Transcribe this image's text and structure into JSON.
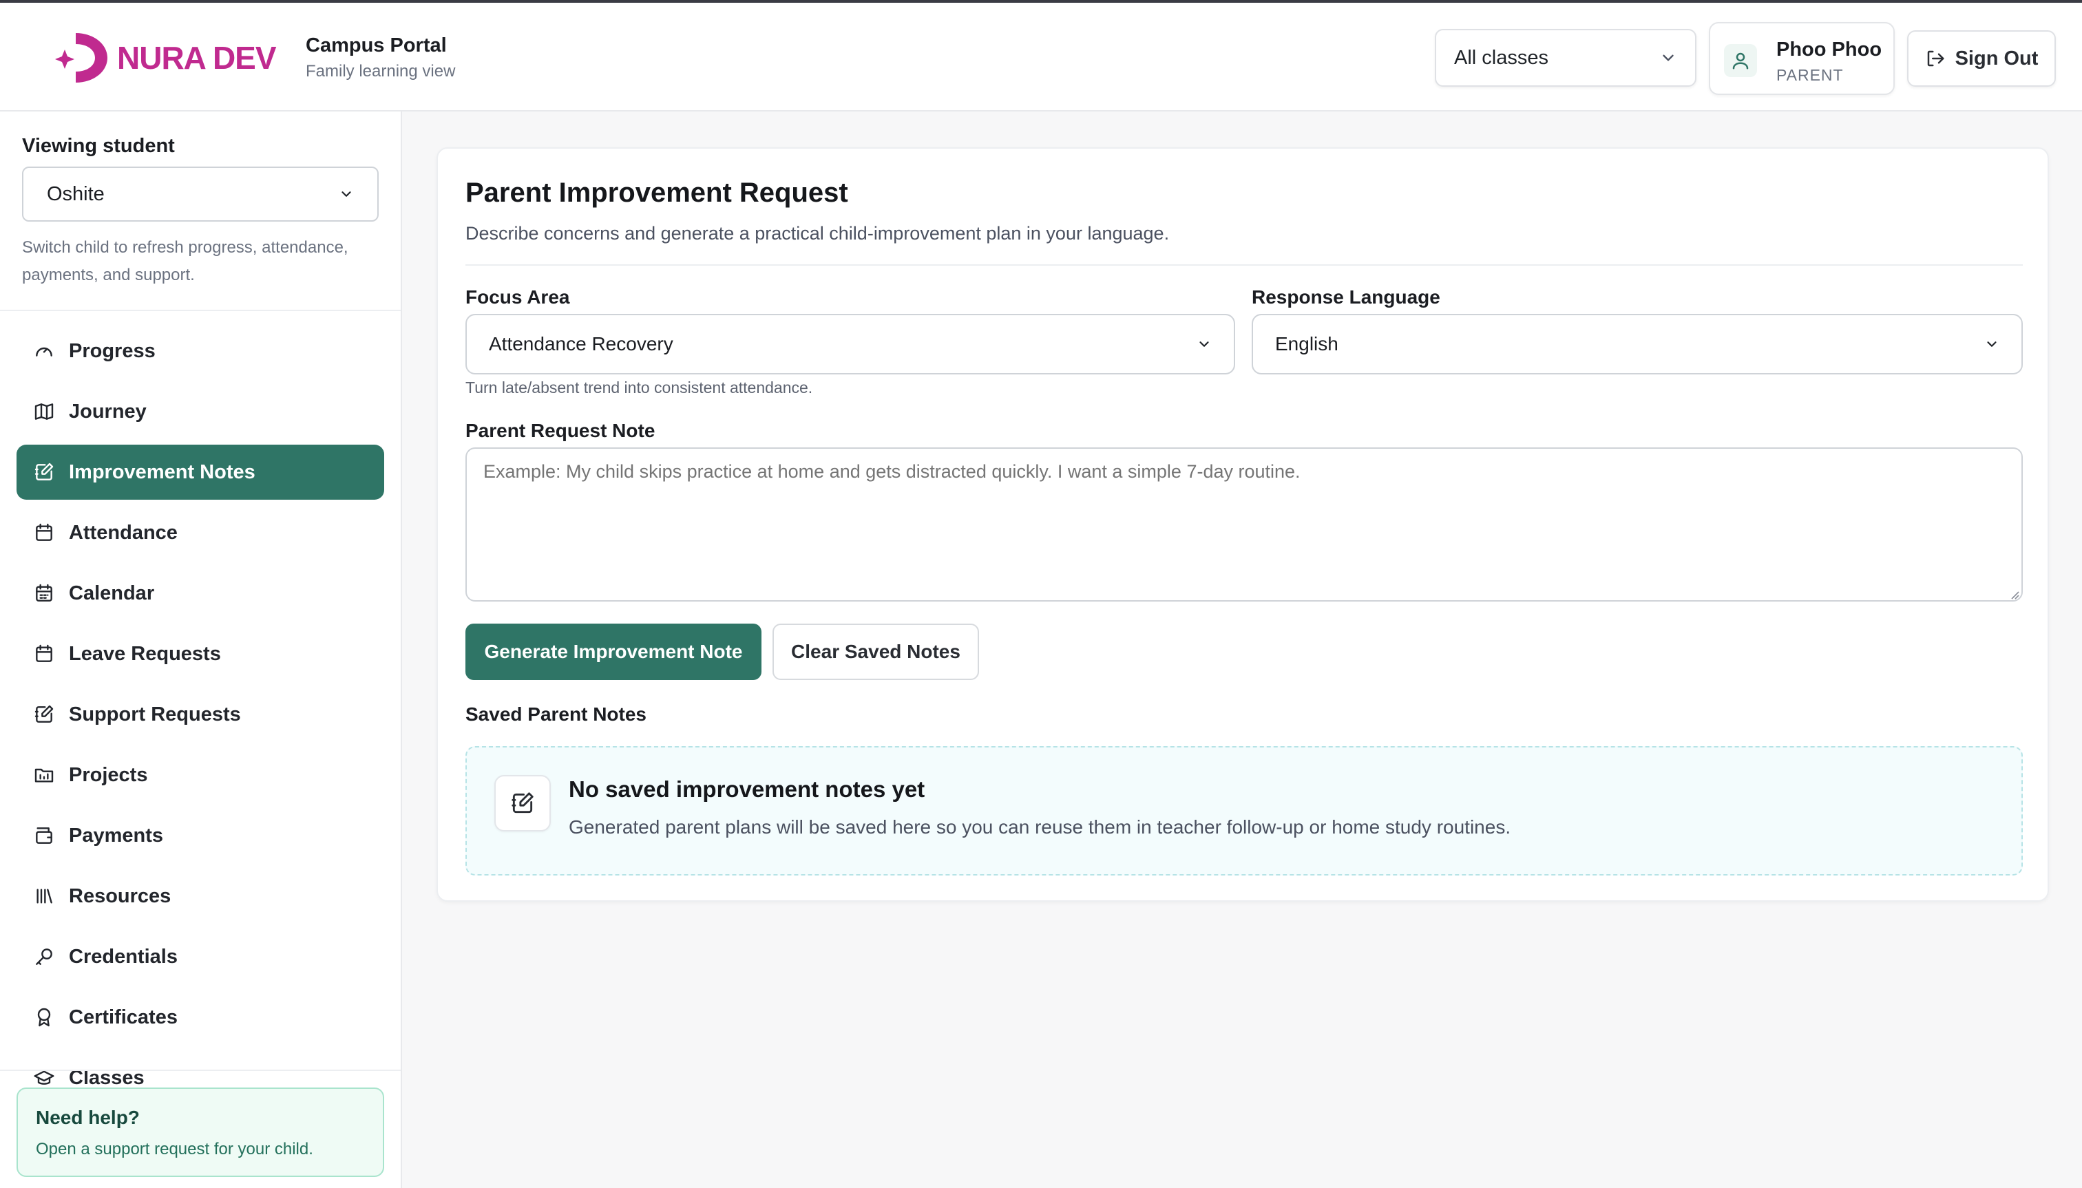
{
  "brand": {
    "name": "NURA DEV",
    "accent": "#c02a8f"
  },
  "header": {
    "title": "Campus Portal",
    "subtitle": "Family learning view",
    "class_filter": {
      "selected": "All classes",
      "icon": "chevron-down-icon"
    },
    "user": {
      "name": "Phoo Phoo",
      "role": "PARENT",
      "icon": "user-icon"
    },
    "sign_out_label": "Sign Out"
  },
  "sidebar": {
    "viewing_label": "Viewing student",
    "student_selected": "Oshite",
    "hint": "Switch child to refresh progress, attendance, payments, and support.",
    "items": [
      {
        "label": "Progress",
        "icon": "gauge-icon",
        "active": false
      },
      {
        "label": "Journey",
        "icon": "map-icon",
        "active": false
      },
      {
        "label": "Improvement Notes",
        "icon": "edit-note-icon",
        "active": true
      },
      {
        "label": "Attendance",
        "icon": "calendar-check-icon",
        "active": false
      },
      {
        "label": "Calendar",
        "icon": "calendar-icon",
        "active": false
      },
      {
        "label": "Leave Requests",
        "icon": "calendar-leave-icon",
        "active": false
      },
      {
        "label": "Support Requests",
        "icon": "edit-note-icon",
        "active": false
      },
      {
        "label": "Projects",
        "icon": "folder-icon",
        "active": false
      },
      {
        "label": "Payments",
        "icon": "wallet-icon",
        "active": false
      },
      {
        "label": "Resources",
        "icon": "library-icon",
        "active": false
      },
      {
        "label": "Credentials",
        "icon": "key-icon",
        "active": false
      },
      {
        "label": "Certificates",
        "icon": "award-icon",
        "active": false
      },
      {
        "label": "Classes",
        "icon": "graduation-cap-icon",
        "active": false
      }
    ],
    "help": {
      "title": "Need help?",
      "text": "Open a support request for your child."
    }
  },
  "main": {
    "title": "Parent Improvement Request",
    "subtitle": "Describe concerns and generate a practical child-improvement plan in your language.",
    "focus_area": {
      "label": "Focus Area",
      "selected": "Attendance Recovery",
      "hint": "Turn late/absent trend into consistent attendance."
    },
    "response_language": {
      "label": "Response Language",
      "selected": "English"
    },
    "request_note": {
      "label": "Parent Request Note",
      "value": "",
      "placeholder": "Example: My child skips practice at home and gets distracted quickly. I want a simple 7-day routine."
    },
    "generate_label": "Generate Improvement Note",
    "clear_label": "Clear Saved Notes",
    "saved_title": "Saved Parent Notes",
    "empty_state": {
      "title": "No saved improvement notes yet",
      "text": "Generated parent plans will be saved here so you can reuse them in teacher follow-up or home study routines."
    }
  },
  "colors": {
    "primary": "#2f7566",
    "help_bg": "#effbf5",
    "empty_bg": "#f3fcfd"
  }
}
